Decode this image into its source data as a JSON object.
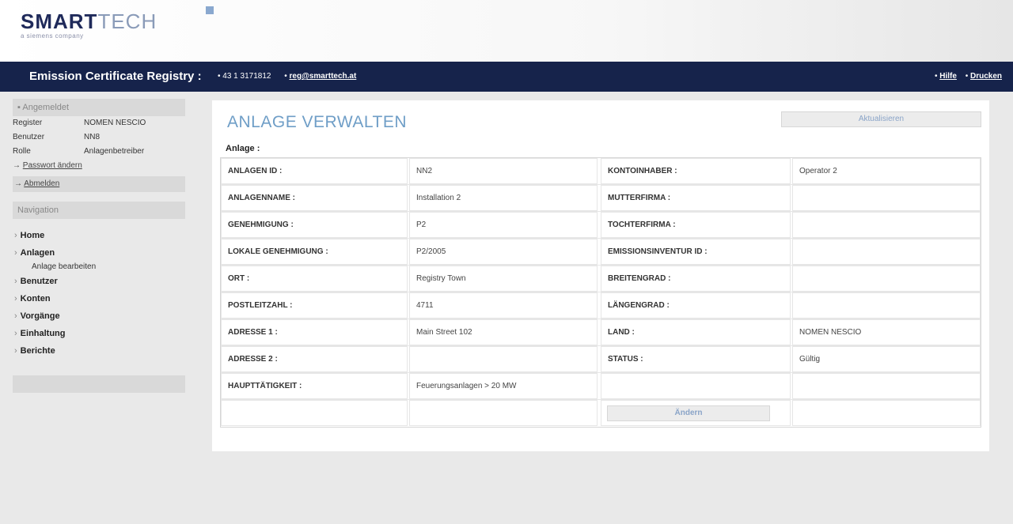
{
  "logo": {
    "brand_smart": "SMART",
    "brand_tech": "TECH",
    "tagline": "a siemens company"
  },
  "topbar": {
    "title": "Emission Certificate Registry :",
    "phone": "• 43 1 3171812",
    "email": "reg@smarttech.at",
    "help": "Hilfe",
    "print": "Drucken"
  },
  "sidebar": {
    "logged_in_header": "Angemeldet",
    "info": [
      {
        "key": "Register",
        "value": "NOMEN NESCIO"
      },
      {
        "key": "Benutzer",
        "value": "NN8"
      },
      {
        "key": "Rolle",
        "value": "Anlagenbetreiber"
      }
    ],
    "change_password": "Passwort ändern",
    "logout": "Abmelden",
    "nav_header": "Navigation",
    "nav": [
      {
        "label": "Home"
      },
      {
        "label": "Anlagen",
        "sub": "Anlage bearbeiten"
      },
      {
        "label": "Benutzer"
      },
      {
        "label": "Konten"
      },
      {
        "label": "Vorgänge"
      },
      {
        "label": "Einhaltung"
      },
      {
        "label": "Berichte"
      }
    ]
  },
  "main": {
    "title": "ANLAGE VERWALTEN",
    "refresh_label": "Aktualisieren",
    "section_label": "Anlage :",
    "rows": [
      {
        "l1": "ANLAGEN ID :",
        "v1": "NN2",
        "l2": "KONTOINHABER :",
        "v2": "Operator 2"
      },
      {
        "l1": "ANLAGENNAME :",
        "v1": "Installation 2",
        "l2": "MUTTERFIRMA :",
        "v2": ""
      },
      {
        "l1": "GENEHMIGUNG :",
        "v1": "P2",
        "l2": "TOCHTERFIRMA :",
        "v2": ""
      },
      {
        "l1": "LOKALE GENEHMIGUNG :",
        "v1": "P2/2005",
        "l2": "EMISSIONSINVENTUR ID :",
        "v2": ""
      },
      {
        "l1": "ORT :",
        "v1": "Registry Town",
        "l2": "BREITENGRAD :",
        "v2": ""
      },
      {
        "l1": "POSTLEITZAHL :",
        "v1": "4711",
        "l2": "LÄNGENGRAD :",
        "v2": ""
      },
      {
        "l1": "ADRESSE 1 :",
        "v1": "Main Street 102",
        "l2": "LAND :",
        "v2": "NOMEN NESCIO"
      },
      {
        "l1": "ADRESSE 2 :",
        "v1": "",
        "l2": "STATUS :",
        "v2": "Gültig"
      },
      {
        "l1": "HAUPTTÄTIGKEIT :",
        "v1": "Feuerungsanlagen > 20 MW",
        "l2": "",
        "v2": ""
      }
    ],
    "change_label": "Ändern"
  }
}
